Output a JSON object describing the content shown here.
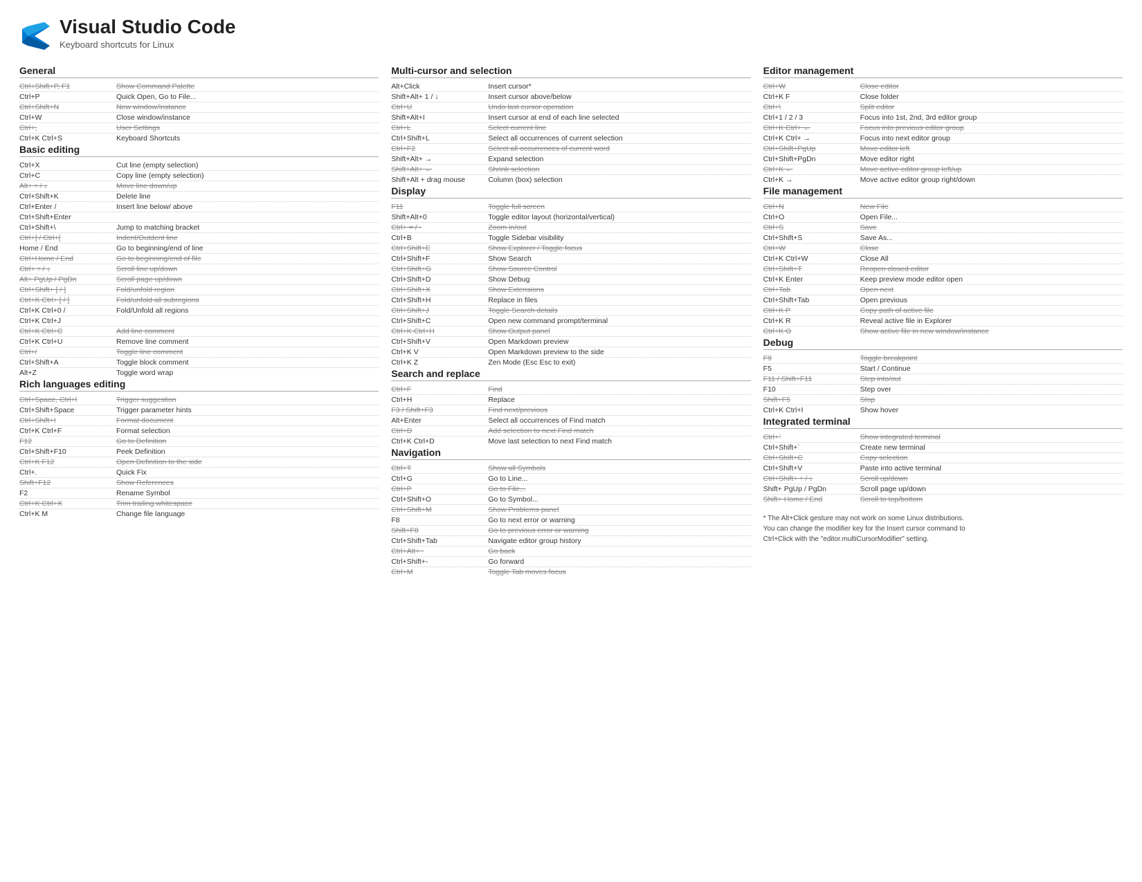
{
  "header": {
    "title": "Visual Studio Code",
    "subtitle": "Keyboard shortcuts for Linux"
  },
  "sections": {
    "col1": [
      {
        "id": "general",
        "title": "General",
        "shortcuts": [
          {
            "key": "Ctrl+Shift+P, F1",
            "desc": "Show Command Palette",
            "strike": true
          },
          {
            "key": "Ctrl+P",
            "desc": "Quick Open, Go to File..."
          },
          {
            "key": "Ctrl+Shift+N",
            "desc": "New window/instance",
            "strike": true
          },
          {
            "key": "Ctrl+W",
            "desc": "Close window/instance"
          },
          {
            "key": "Ctrl+,",
            "desc": "User Settings",
            "strike": true
          },
          {
            "key": "Ctrl+K Ctrl+S",
            "desc": "Keyboard Shortcuts"
          }
        ]
      },
      {
        "id": "basic-editing",
        "title": "Basic editing",
        "shortcuts": [
          {
            "key": "Ctrl+X",
            "desc": "Cut line (empty selection)"
          },
          {
            "key": "Ctrl+C",
            "desc": "Copy line (empty selection)"
          },
          {
            "key": "Alt+ ↑ / ↓",
            "desc": "Move line down/up",
            "strike": true
          },
          {
            "key": "Ctrl+Shift+K",
            "desc": "Delete line"
          },
          {
            "key": "Ctrl+Enter /",
            "desc": "Insert line below/ above"
          },
          {
            "key": "Ctrl+Shift+Enter",
            "desc": ""
          },
          {
            "key": "Ctrl+Shift+\\",
            "desc": "Jump to matching bracket"
          },
          {
            "key": "Ctrl+] / Ctrl+[",
            "desc": "Indent/Outdent line",
            "strike": true
          },
          {
            "key": "Home / End",
            "desc": "Go to beginning/end of line"
          },
          {
            "key": "Ctrl+Home / End",
            "desc": "Go to beginning/end of file",
            "strike": true
          },
          {
            "key": "Ctrl+ ↑ / ↓",
            "desc": "Scroll line up/down",
            "strike": true
          },
          {
            "key": "Alt+ PgUp / PgDn",
            "desc": "Scroll page up/down",
            "strike": true
          },
          {
            "key": "Ctrl+Shift+ [ / ]",
            "desc": "Fold/unfold region",
            "strike": true
          },
          {
            "key": "Ctrl+K Ctrl+ [ / ]",
            "desc": "Fold/unfold all subregions",
            "strike": true
          },
          {
            "key": "Ctrl+K Ctrl+0 /",
            "desc": "Fold/Unfold all regions"
          },
          {
            "key": "Ctrl+K Ctrl+J",
            "desc": ""
          },
          {
            "key": "Ctrl+K Ctrl+C",
            "desc": "Add line comment",
            "strike": true
          },
          {
            "key": "Ctrl+K Ctrl+U",
            "desc": "Remove line comment"
          },
          {
            "key": "Ctrl+/",
            "desc": "Toggle line comment",
            "strike": true
          },
          {
            "key": "Ctrl+Shift+A",
            "desc": "Toggle block comment"
          },
          {
            "key": "Alt+Z",
            "desc": "Toggle word wrap"
          }
        ]
      },
      {
        "id": "rich-languages",
        "title": "Rich languages editing",
        "shortcuts": [
          {
            "key": "Ctrl+Space, Ctrl+I",
            "desc": "Trigger suggestion",
            "strike": true
          },
          {
            "key": "Ctrl+Shift+Space",
            "desc": "Trigger parameter hints"
          },
          {
            "key": "Ctrl+Shift+I",
            "desc": "Format document",
            "strike": true
          },
          {
            "key": "Ctrl+K Ctrl+F",
            "desc": "Format selection"
          },
          {
            "key": "F12",
            "desc": "Go to Definition",
            "strike": true
          },
          {
            "key": "Ctrl+Shift+F10",
            "desc": "Peek Definition"
          },
          {
            "key": "Ctrl+K F12",
            "desc": "Open Definition to the side",
            "strike": true
          },
          {
            "key": "Ctrl+.",
            "desc": "Quick Fix"
          },
          {
            "key": "Shift+F12",
            "desc": "Show References",
            "strike": true
          },
          {
            "key": "F2",
            "desc": "Rename Symbol"
          },
          {
            "key": "Ctrl+K Ctrl+X",
            "desc": "Trim trailing whitespace",
            "strike": true
          },
          {
            "key": "Ctrl+K M",
            "desc": "Change file language"
          }
        ]
      }
    ],
    "col2": [
      {
        "id": "multi-cursor",
        "title": "Multi-cursor and selection",
        "shortcuts": [
          {
            "key": "Alt+Click",
            "desc": "Insert cursor*"
          },
          {
            "key": "Shift+Alt+ 1 / ↓",
            "desc": "Insert cursor above/below"
          },
          {
            "key": "Ctrl+U",
            "desc": "Undo last cursor operation",
            "strike": true
          },
          {
            "key": "Shift+Alt+I",
            "desc": "Insert cursor at end of each line selected"
          },
          {
            "key": "Ctrl+L",
            "desc": "Select current line",
            "strike": true
          },
          {
            "key": "Ctrl+Shift+L",
            "desc": "Select all occurrences of current selection"
          },
          {
            "key": "Ctrl+F2",
            "desc": "Select all occurrences of current word",
            "strike": true
          },
          {
            "key": "Shift+Alt+ →",
            "desc": "Expand selection"
          },
          {
            "key": "Shift+Alt+ ←",
            "desc": "Shrink selection",
            "strike": true
          },
          {
            "key": "Shift+Alt + drag mouse",
            "desc": "Column (box) selection"
          }
        ]
      },
      {
        "id": "display",
        "title": "Display",
        "shortcuts": [
          {
            "key": "F11",
            "desc": "Toggle full screen",
            "strike": true
          },
          {
            "key": "Shift+Alt+0",
            "desc": "Toggle editor layout (horizontal/vertical)"
          },
          {
            "key": "Ctrl+ = / -",
            "desc": "Zoom in/out",
            "strike": true
          },
          {
            "key": "Ctrl+B",
            "desc": "Toggle Sidebar visibility"
          },
          {
            "key": "Ctrl+Shift+E",
            "desc": "Show Explorer / Toggle focus",
            "strike": true
          },
          {
            "key": "Ctrl+Shift+F",
            "desc": "Show Search"
          },
          {
            "key": "Ctrl+Shift+G",
            "desc": "Show Source Control",
            "strike": true
          },
          {
            "key": "Ctrl+Shift+D",
            "desc": "Show Debug"
          },
          {
            "key": "Ctrl+Shift+X",
            "desc": "Show Extensions",
            "strike": true
          },
          {
            "key": "Ctrl+Shift+H",
            "desc": "Replace in files"
          },
          {
            "key": "Ctrl+Shift+J",
            "desc": "Toggle Search details",
            "strike": true
          },
          {
            "key": "Ctrl+Shift+C",
            "desc": "Open new command prompt/terminal"
          },
          {
            "key": "Ctrl+K Ctrl+H",
            "desc": "Show Output panel",
            "strike": true
          },
          {
            "key": "Ctrl+Shift+V",
            "desc": "Open Markdown preview"
          },
          {
            "key": "Ctrl+K V",
            "desc": "Open Markdown preview to the side"
          },
          {
            "key": "Ctrl+K Z",
            "desc": "Zen Mode (Esc Esc to exit)"
          }
        ]
      },
      {
        "id": "search-replace",
        "title": "Search and replace",
        "shortcuts": [
          {
            "key": "Ctrl+F",
            "desc": "Find",
            "strike": true
          },
          {
            "key": "Ctrl+H",
            "desc": "Replace"
          },
          {
            "key": "F3 / Shift+F3",
            "desc": "Find next/previous",
            "strike": true
          },
          {
            "key": "Alt+Enter",
            "desc": "Select all occurrences of Find match"
          },
          {
            "key": "Ctrl+D",
            "desc": "Add selection to next Find match",
            "strike": true
          },
          {
            "key": "Ctrl+K Ctrl+D",
            "desc": "Move last selection to next Find match"
          }
        ]
      },
      {
        "id": "navigation",
        "title": "Navigation",
        "shortcuts": [
          {
            "key": "Ctrl+T",
            "desc": "Show all Symbols",
            "strike": true
          },
          {
            "key": "Ctrl+G",
            "desc": "Go to Line..."
          },
          {
            "key": "Ctrl+P",
            "desc": "Go to File...",
            "strike": true
          },
          {
            "key": "Ctrl+Shift+O",
            "desc": "Go to Symbol..."
          },
          {
            "key": "Ctrl+Shift+M",
            "desc": "Show Problems panel",
            "strike": true
          },
          {
            "key": "F8",
            "desc": "Go to next error or warning"
          },
          {
            "key": "Shift+F8",
            "desc": "Go to previous error or warning",
            "strike": true
          },
          {
            "key": "Ctrl+Shift+Tab",
            "desc": "Navigate editor group history"
          },
          {
            "key": "Ctrl+Alt+−",
            "desc": "Go back",
            "strike": true
          },
          {
            "key": "Ctrl+Shift+-",
            "desc": "Go forward"
          },
          {
            "key": "Ctrl+M",
            "desc": "Toggle Tab moves focus",
            "strike": true
          }
        ]
      }
    ],
    "col3": [
      {
        "id": "editor-management",
        "title": "Editor management",
        "shortcuts": [
          {
            "key": "Ctrl+W",
            "desc": "Close editor",
            "strike": true
          },
          {
            "key": "Ctrl+K F",
            "desc": "Close folder"
          },
          {
            "key": "Ctrl+\\",
            "desc": "Split editor",
            "strike": true
          },
          {
            "key": "Ctrl+1 / 2 / 3",
            "desc": "Focus into 1st, 2nd, 3rd editor group"
          },
          {
            "key": "Ctrl+K Ctrl+ ←",
            "desc": "Focus into previous editor group",
            "strike": true
          },
          {
            "key": "Ctrl+K Ctrl+ →",
            "desc": "Focus into next editor group"
          },
          {
            "key": "Ctrl+Shift+PgUp",
            "desc": "Move editor left",
            "strike": true
          },
          {
            "key": "Ctrl+Shift+PgDn",
            "desc": "Move editor right"
          },
          {
            "key": "Ctrl+K ←",
            "desc": "Move active editor group left/up",
            "strike": true
          },
          {
            "key": "Ctrl+K →",
            "desc": "Move active editor group right/down"
          }
        ]
      },
      {
        "id": "file-management",
        "title": "File management",
        "shortcuts": [
          {
            "key": "Ctrl+N",
            "desc": "New File",
            "strike": true
          },
          {
            "key": "Ctrl+O",
            "desc": "Open File..."
          },
          {
            "key": "Ctrl+S",
            "desc": "Save",
            "strike": true
          },
          {
            "key": "Ctrl+Shift+S",
            "desc": "Save As..."
          },
          {
            "key": "Ctrl+W",
            "desc": "Close",
            "strike": true
          },
          {
            "key": "Ctrl+K Ctrl+W",
            "desc": "Close All"
          },
          {
            "key": "Ctrl+Shift+T",
            "desc": "Reopen closed editor",
            "strike": true
          },
          {
            "key": "Ctrl+K Enter",
            "desc": "Keep preview mode editor open"
          },
          {
            "key": "Ctrl+Tab",
            "desc": "Open next",
            "strike": true
          },
          {
            "key": "Ctrl+Shift+Tab",
            "desc": "Open previous"
          },
          {
            "key": "Ctrl+K P",
            "desc": "Copy path of active file",
            "strike": true
          },
          {
            "key": "Ctrl+K R",
            "desc": "Reveal active file in Explorer"
          },
          {
            "key": "Ctrl+K O",
            "desc": "Show active file in new window/instance",
            "strike": true
          }
        ]
      },
      {
        "id": "debug",
        "title": "Debug",
        "shortcuts": [
          {
            "key": "F9",
            "desc": "Toggle breakpoint",
            "strike": true
          },
          {
            "key": "F5",
            "desc": "Start / Continue"
          },
          {
            "key": "F11 / Shift+F11",
            "desc": "Step into/out",
            "strike": true
          },
          {
            "key": "F10",
            "desc": "Step over"
          },
          {
            "key": "Shift+F5",
            "desc": "Stop",
            "strike": true
          },
          {
            "key": "Ctrl+K Ctrl+I",
            "desc": "Show hover"
          }
        ]
      },
      {
        "id": "integrated-terminal",
        "title": "Integrated terminal",
        "shortcuts": [
          {
            "key": "Ctrl+`",
            "desc": "Show integrated terminal",
            "strike": true
          },
          {
            "key": "Ctrl+Shift+`",
            "desc": "Create new terminal"
          },
          {
            "key": "Ctrl+Shift+C",
            "desc": "Copy selection",
            "strike": true
          },
          {
            "key": "Ctrl+Shift+V",
            "desc": "Paste into active terminal"
          },
          {
            "key": "Ctrl+Shift+ ↑ / ↓",
            "desc": "Scroll up/down",
            "strike": true
          },
          {
            "key": "Shift+ PgUp / PgDn",
            "desc": "Scroll page up/down"
          },
          {
            "key": "Shift+ Home / End",
            "desc": "Scroll to top/bottom",
            "strike": true
          }
        ]
      }
    ]
  },
  "footnote": "* The Alt+Click gesture may not work on some Linux distributions.\nYou can change the modifier key for the Insert cursor command to\nCtrl+Click with the \"editor.multiCursorModifier\" setting."
}
